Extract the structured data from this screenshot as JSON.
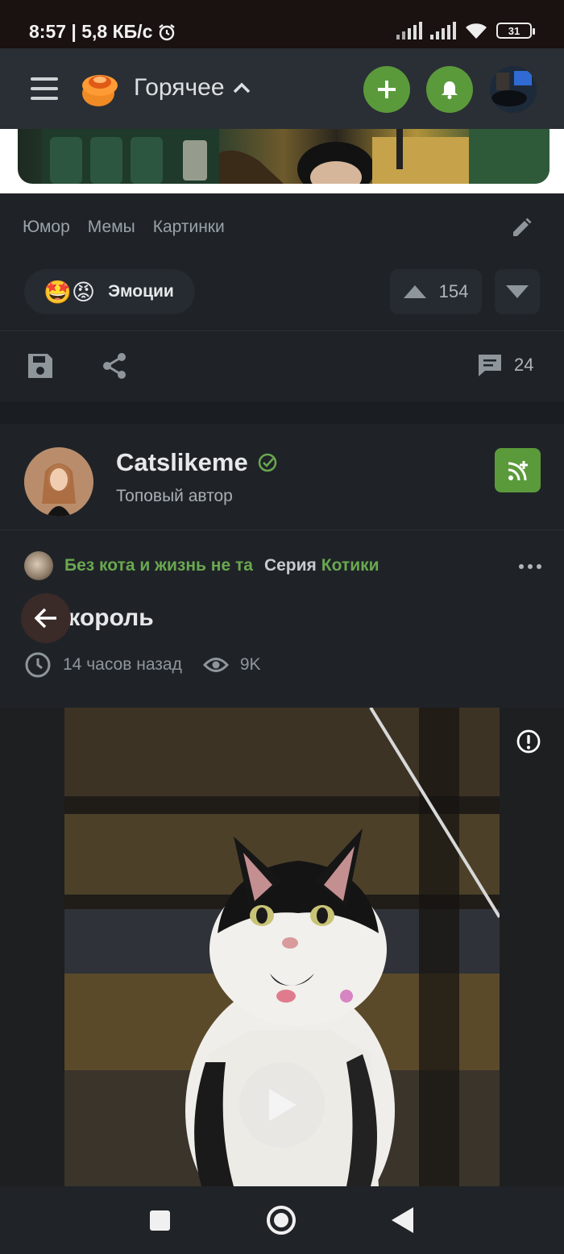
{
  "status_bar": {
    "time_and_speed": "8:57 | 5,8 КБ/с",
    "battery": "31"
  },
  "top_bar": {
    "feed_title": "Горячее"
  },
  "post_footer": {
    "tags": [
      "Юмор",
      "Мемы",
      "Картинки"
    ],
    "community": {
      "emoji": "🤩😡",
      "label": "Эмоции"
    },
    "rating": "154",
    "comments_count": "24"
  },
  "next_post": {
    "author": {
      "name": "Catslikeme",
      "rank": "Топовый автор"
    },
    "group": "Без кота и жизнь не та",
    "series_word": "Серия",
    "series_name": "Котики",
    "title": "окороль",
    "time_ago": "14 часов назад",
    "views": "9K"
  },
  "colors": {
    "accent_green": "#5b9a3b",
    "link_green": "#6aa84f",
    "background": "#1f2328"
  },
  "icons": [
    "menu-icon",
    "plus-icon",
    "bell-icon",
    "chevron-up-icon",
    "pencil-icon",
    "arrow-up-icon",
    "arrow-down-icon",
    "save-icon",
    "share-icon",
    "comment-icon",
    "verified-icon",
    "rss-plus-icon",
    "more-icon",
    "arrow-left-icon",
    "clock-icon",
    "eye-icon",
    "alert-icon",
    "play-icon"
  ]
}
